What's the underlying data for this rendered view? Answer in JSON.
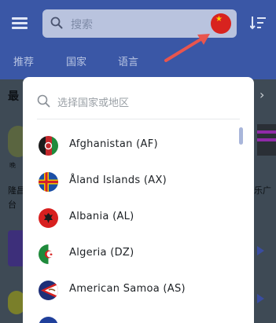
{
  "header": {
    "search_placeholder": "搜索",
    "tabs": [
      "推荐",
      "国家",
      "语言"
    ],
    "icons": {
      "menu": "menu-icon",
      "search": "search-icon",
      "country_flag": "china-flag-icon",
      "sort": "sort-icon"
    }
  },
  "background": {
    "section_title": "最",
    "small_label": "晚",
    "line1": "隆昌",
    "line2": "台",
    "right_line": "乐广"
  },
  "dialog": {
    "search_placeholder": "选择国家或地区",
    "countries": [
      {
        "label": "Afghanistan (AF)",
        "flag": "afghanistan-flag-icon"
      },
      {
        "label": "Åland Islands (AX)",
        "flag": "aland-flag-icon"
      },
      {
        "label": "Albania (AL)",
        "flag": "albania-flag-icon"
      },
      {
        "label": "Algeria (DZ)",
        "flag": "algeria-flag-icon"
      },
      {
        "label": "American Samoa (AS)",
        "flag": "american-samoa-flag-icon"
      }
    ]
  },
  "colors": {
    "appbar": "#3a57a6",
    "accent": "#4a6ed0",
    "arrow": "#e8554e"
  }
}
